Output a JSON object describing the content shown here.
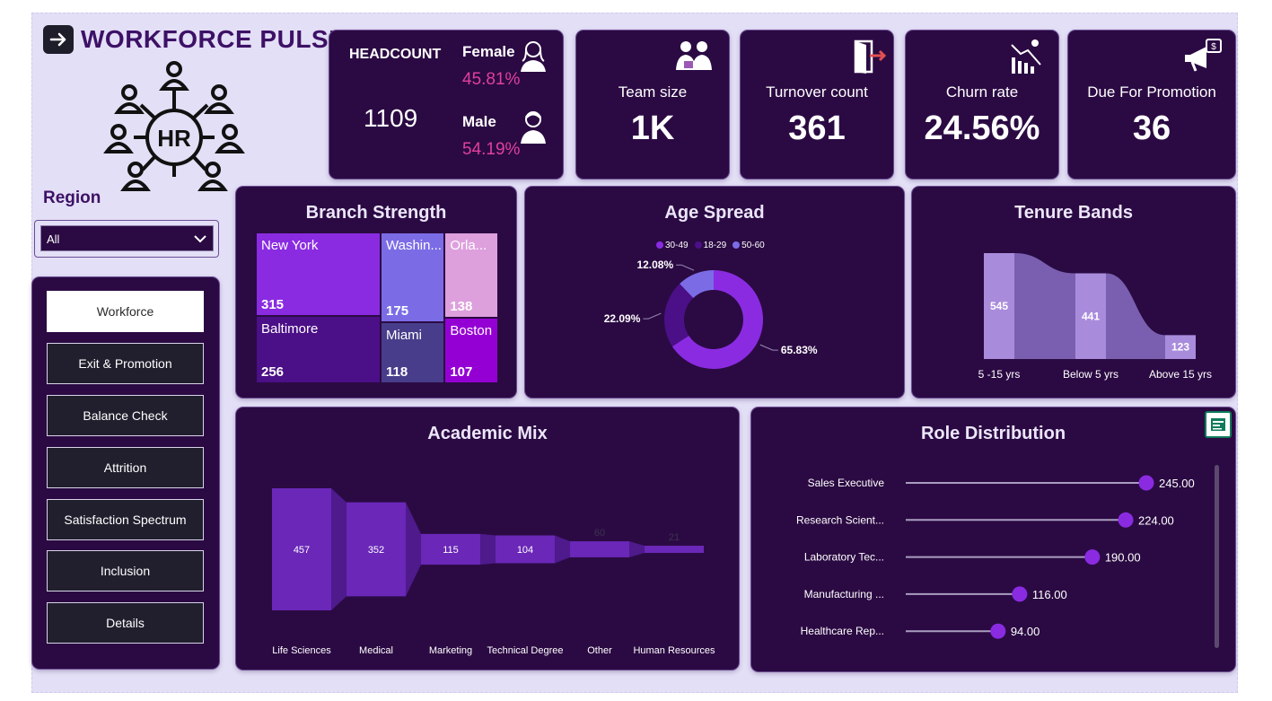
{
  "header": {
    "title": "WORKFORCE PULSE",
    "logo_text": "HR"
  },
  "filter": {
    "label": "Region",
    "selected": "All"
  },
  "nav": {
    "items": [
      {
        "label": "Workforce"
      },
      {
        "label": "Exit & Promotion"
      },
      {
        "label": "Balance Check"
      },
      {
        "label": "Attrition"
      },
      {
        "label": "Satisfaction Spectrum"
      },
      {
        "label": "Inclusion"
      },
      {
        "label": "Details"
      }
    ]
  },
  "headcount": {
    "label": "HEADCOUNT",
    "value": "1109",
    "female_label": "Female",
    "female_pct": "45.81%",
    "male_label": "Male",
    "male_pct": "54.19%"
  },
  "kpis": [
    {
      "label": "Team size",
      "value": "1K",
      "icon": "team-icon"
    },
    {
      "label": "Turnover count",
      "value": "361",
      "icon": "exit-door-icon"
    },
    {
      "label": "Churn rate",
      "value": "24.56%",
      "icon": "declining-chart-icon"
    },
    {
      "label": "Due For Promotion",
      "value": "36",
      "icon": "megaphone-icon"
    }
  ],
  "colors": {
    "panel": "#2b0a43",
    "accent": "#8a2be2",
    "pink": "#e0409c",
    "canvas": "#e3dff6"
  },
  "chart_data": [
    {
      "type": "treemap",
      "title": "Branch Strength",
      "categories": [
        "New York",
        "Baltimore",
        "Washin...",
        "Miami",
        "Orla...",
        "Boston"
      ],
      "values": [
        315,
        256,
        175,
        118,
        138,
        107
      ],
      "colors": [
        "#8a2be2",
        "#4b0f87",
        "#7b6ce6",
        "#483d8b",
        "#dda0dd",
        "#9400d3"
      ]
    },
    {
      "type": "pie",
      "title": "Age Spread",
      "categories": [
        "30-49",
        "18-29",
        "50-60"
      ],
      "values": [
        65.83,
        22.09,
        12.08
      ],
      "labels": [
        "65.83%",
        "22.09%",
        "12.08%"
      ],
      "colors": [
        "#8a2be2",
        "#4b0f87",
        "#7b6ce6"
      ],
      "legend": "top"
    },
    {
      "type": "area",
      "title": "Tenure Bands",
      "categories": [
        "5 -15 yrs",
        "Below 5 yrs",
        "Above 15 yrs"
      ],
      "values": [
        545,
        441,
        123
      ]
    },
    {
      "type": "bar",
      "title": "Academic Mix",
      "categories": [
        "Life Sciences",
        "Medical",
        "Marketing",
        "Technical Degree",
        "Other",
        "Human Resources"
      ],
      "values": [
        457,
        352,
        115,
        104,
        60,
        21
      ]
    },
    {
      "type": "scatter",
      "title": "Role Distribution",
      "categories": [
        "Sales Executive",
        "Research Scient...",
        "Laboratory Tec...",
        "Manufacturing ...",
        "Healthcare Rep..."
      ],
      "values": [
        245,
        224,
        190,
        116,
        94
      ],
      "labels": [
        "245.00",
        "224.00",
        "190.00",
        "116.00",
        "94.00"
      ]
    }
  ]
}
